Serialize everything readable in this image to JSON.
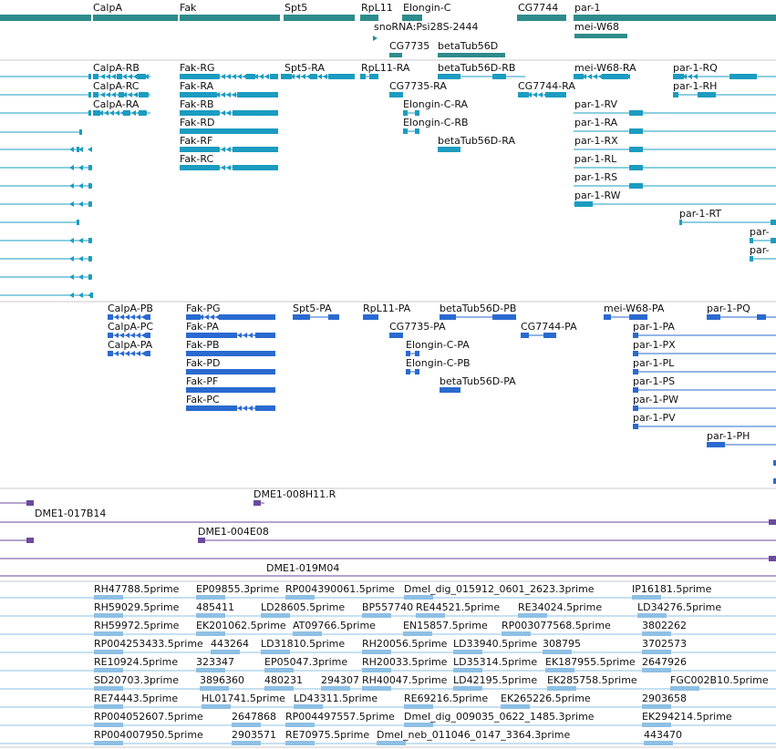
{
  "colors": {
    "gene": "#2e8b8b",
    "mrna": "#1b9cc0",
    "cds": "#2a6ad0",
    "clone": "#6a4a9e",
    "est": "#8ec0e4",
    "sep": "#c8c8c8",
    "label": "#111111"
  },
  "tracks": {
    "gene": {
      "row_labels": [
        [
          "CalpA",
          "Fak",
          "Spt5",
          "RpL11",
          "Elongin-C",
          "CG7744",
          "par-1"
        ],
        [
          "snoRNA:Psi28S-2444",
          "mei-W68"
        ],
        [
          "CG7735",
          "betaTub56D"
        ]
      ]
    },
    "mrna": {
      "row_labels": [
        [
          "CalpA-RB",
          "Fak-RG",
          "Spt5-RA",
          "RpL11-RA",
          "betaTub56D-RB",
          "mei-W68-RA",
          "par-1-RQ"
        ],
        [
          "CalpA-RC",
          "Fak-RA",
          "CG7735-RA",
          "CG7744-RA",
          "par-1-RH"
        ],
        [
          "CalpA-RA",
          "Fak-RB",
          "Elongin-C-RA",
          "par-1-RV"
        ],
        [
          "Fak-RD",
          "Elongin-C-RB",
          "par-1-RA"
        ],
        [
          "Fak-RF",
          "betaTub56D-RA",
          "par-1-RX"
        ],
        [
          "Fak-RC",
          "par-1-RL"
        ],
        [
          "par-1-RS"
        ],
        [
          "par-1-RW"
        ],
        [
          "par-1-RT"
        ],
        [
          "par-"
        ],
        [
          "par-"
        ]
      ]
    },
    "cds": {
      "row_labels": [
        [
          "CalpA-PB",
          "Fak-PG",
          "Spt5-PA",
          "RpL11-PA",
          "betaTub56D-PB",
          "mei-W68-PA",
          "par-1-PQ"
        ],
        [
          "CalpA-PC",
          "Fak-PA",
          "CG7735-PA",
          "CG7744-PA",
          "par-1-PA"
        ],
        [
          "CalpA-PA",
          "Fak-PB",
          "Elongin-C-PA",
          "par-1-PX"
        ],
        [
          "Fak-PD",
          "Elongin-C-PB",
          "par-1-PL"
        ],
        [
          "Fak-PF",
          "betaTub56D-PA",
          "par-1-PS"
        ],
        [
          "Fak-PC",
          "par-1-PW"
        ],
        [
          "par-1-PV"
        ],
        [
          "par-1-PH"
        ]
      ]
    },
    "clones": {
      "labels": [
        "DME1-008H11.R",
        "DME1-017B14",
        "DME1-004E08",
        "DME1-019M04"
      ]
    },
    "ests": {
      "rows": [
        [
          "RH47788.5prime",
          "EP09855.3prime",
          "RP004390061.5prime",
          "Dmel_dig_015912_0601_2623.3prime",
          "IP16181.5prime"
        ],
        [
          "RH59029.5prime",
          "485411",
          "LD28605.5prime",
          "BP557740",
          "RE44521.5prime",
          "RE34024.5prime",
          "LD34276.5prime"
        ],
        [
          "RH59972.5prime",
          "EK201062.5prime",
          "AT09766.5prime",
          "EN15857.5prime",
          "RP003077568.5prime",
          "3802262"
        ],
        [
          "RP004253433.5prime",
          "443264",
          "LD31810.5prime",
          "RH20056.5prime",
          "LD33940.5prime",
          "308795",
          "3702573"
        ],
        [
          "RE10924.5prime",
          "323347",
          "EP05047.3prime",
          "RH20033.5prime",
          "LD35314.5prime",
          "EK187955.5prime",
          "2647926"
        ],
        [
          "SD20703.3prime",
          "3896360",
          "480231",
          "294307",
          "RH40047.5prime",
          "LD42195.5prime",
          "EK285758.5prime",
          "FGC002B10.5prime"
        ],
        [
          "RE74443.5prime",
          "HL01741.5prime",
          "LD43311.5prime",
          "RE69216.5prime",
          "EK265226.5prime",
          "2903658"
        ],
        [
          "RP004052607.5prime",
          "2647868",
          "RP004497557.5prime",
          "Dmel_dig_009035_0622_1485.3prime",
          "EK294214.5prime"
        ],
        [
          "RP004007950.5prime",
          "2903571",
          "RE70975.5prime",
          "Dmel_neb_011046_0147_3364.3prime",
          "443470"
        ]
      ]
    }
  }
}
